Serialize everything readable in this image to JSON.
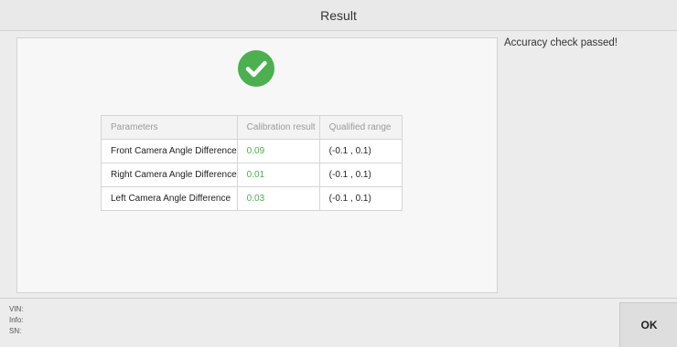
{
  "window": {
    "title": "Result"
  },
  "result": {
    "status_icon": "check-circle-icon",
    "status_color": "#4caf50",
    "table": {
      "headers": [
        "Parameters",
        "Calibration result",
        "Qualified range"
      ],
      "rows": [
        {
          "parameter": "Front Camera Angle Difference",
          "result": "0.09",
          "range": "(-0.1 , 0.1)"
        },
        {
          "parameter": "Right Camera Angle Difference",
          "result": "0.01",
          "range": "(-0.1 , 0.1)"
        },
        {
          "parameter": "Left Camera Angle Difference",
          "result": "0.03",
          "range": "(-0.1 , 0.1)"
        }
      ]
    }
  },
  "message": "Accuracy check passed!",
  "device_info": {
    "vin_label": "VIN:",
    "info_label": "Info:",
    "sn_label": "SN:"
  },
  "actions": {
    "ok_label": "OK"
  }
}
